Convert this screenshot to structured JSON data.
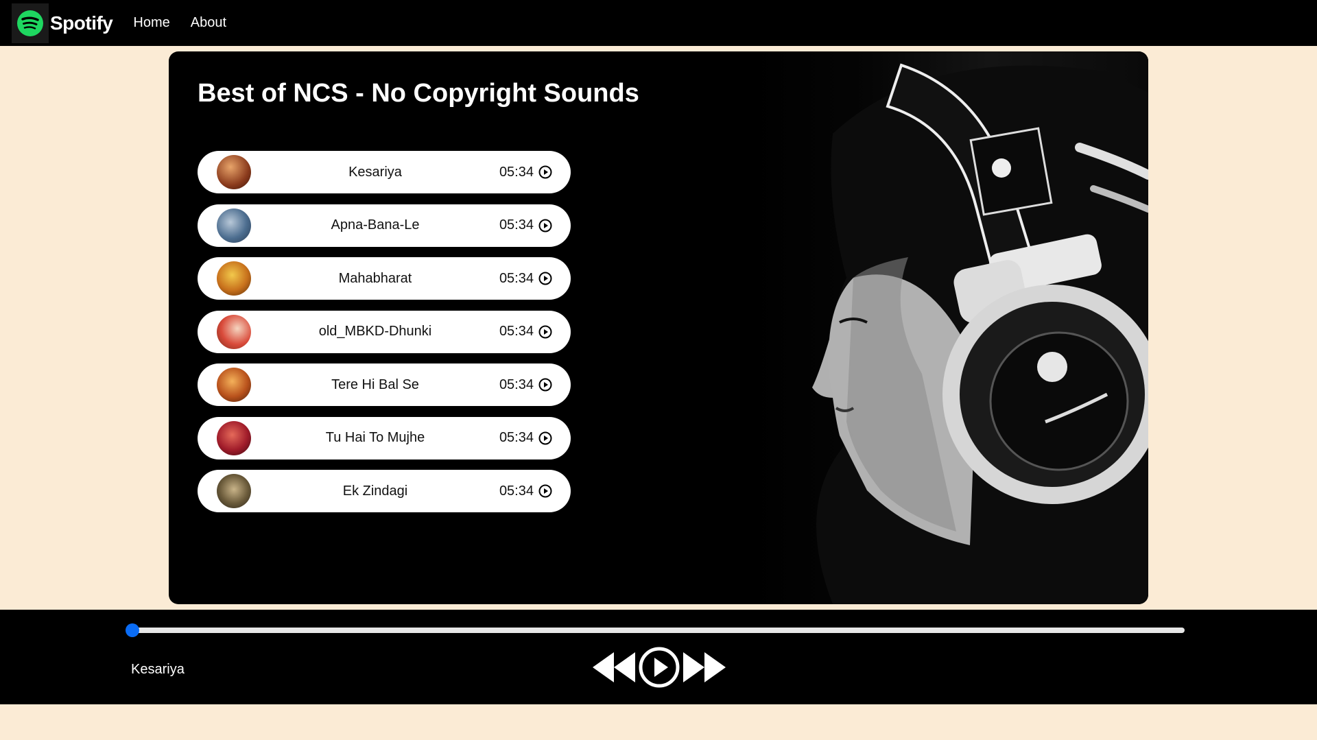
{
  "nav": {
    "brand": "Spotify",
    "links": [
      "Home",
      "About"
    ]
  },
  "playlist": {
    "title": "Best of NCS - No Copyright Sounds",
    "songs": [
      {
        "name": "Kesariya",
        "duration": "05:34"
      },
      {
        "name": "Apna-Bana-Le",
        "duration": "05:34"
      },
      {
        "name": "Mahabharat",
        "duration": "05:34"
      },
      {
        "name": "old_MBKD-Dhunki",
        "duration": "05:34"
      },
      {
        "name": "Tere Hi Bal Se",
        "duration": "05:34"
      },
      {
        "name": "Tu Hai To Mujhe",
        "duration": "05:34"
      },
      {
        "name": "Ek Zindagi",
        "duration": "05:34"
      }
    ]
  },
  "player": {
    "now_playing": "Kesariya",
    "progress_percent": 0
  },
  "colors": {
    "page_background": "#fbebd5",
    "spotify_green": "#1ed760",
    "progress_accent": "#0a6cf5"
  },
  "icons": {
    "logo": "spotify-logo-icon",
    "song_play": "play-circle-icon",
    "previous": "backward-icon",
    "play": "play-circle-icon",
    "next": "forward-icon"
  }
}
